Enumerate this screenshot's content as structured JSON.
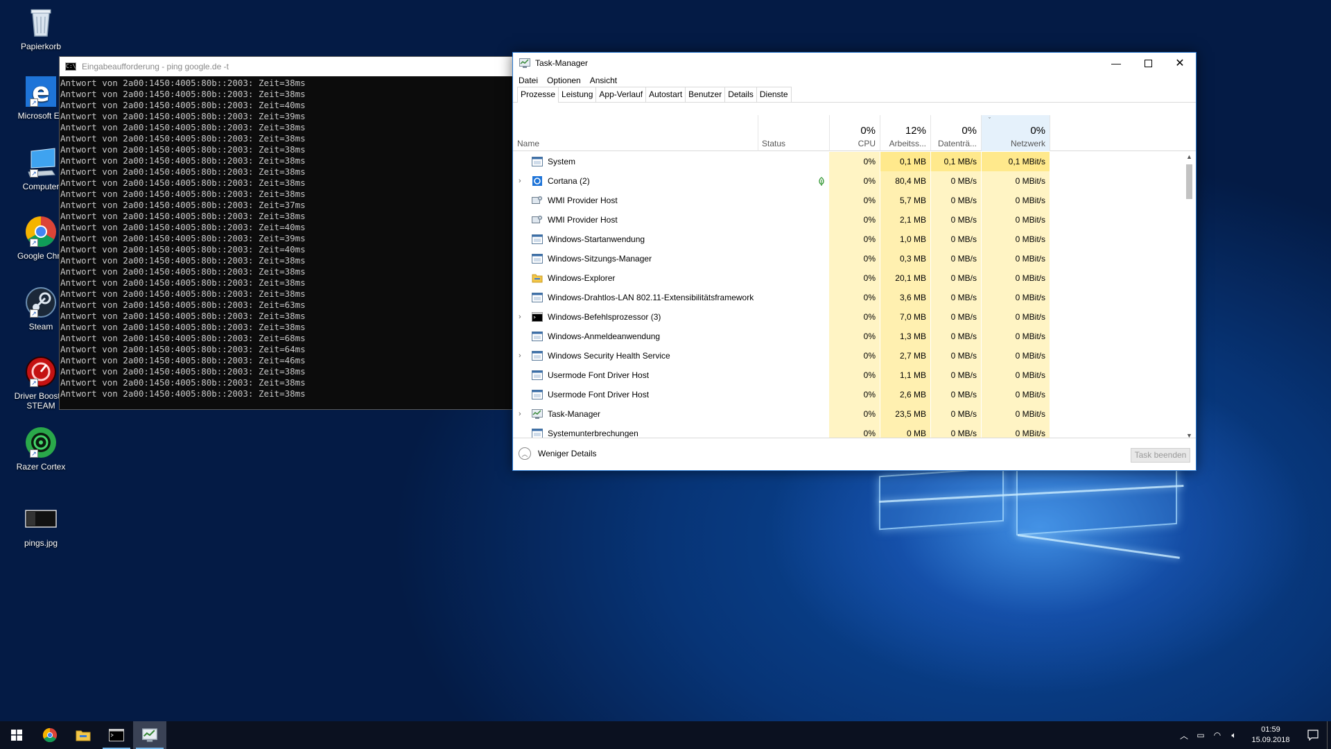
{
  "desktop": {
    "icons": [
      {
        "name": "recycle-bin",
        "label": "Papierkorb"
      },
      {
        "name": "edge",
        "label": "Microsoft Ed"
      },
      {
        "name": "computer",
        "label": "Computer"
      },
      {
        "name": "chrome",
        "label": "Google Chro"
      },
      {
        "name": "steam",
        "label": "Steam"
      },
      {
        "name": "driver-booster",
        "label": "Driver Booster STEAM"
      },
      {
        "name": "razer-cortex",
        "label": "Razer Cortex"
      },
      {
        "name": "pings-jpg",
        "label": "pings.jpg"
      }
    ]
  },
  "cmd": {
    "title": "Eingabeaufforderung - ping  google.de -t",
    "lines": [
      "Antwort von 2a00:1450:4005:80b::2003: Zeit=38ms",
      "Antwort von 2a00:1450:4005:80b::2003: Zeit=38ms",
      "Antwort von 2a00:1450:4005:80b::2003: Zeit=40ms",
      "Antwort von 2a00:1450:4005:80b::2003: Zeit=39ms",
      "Antwort von 2a00:1450:4005:80b::2003: Zeit=38ms",
      "Antwort von 2a00:1450:4005:80b::2003: Zeit=38ms",
      "Antwort von 2a00:1450:4005:80b::2003: Zeit=38ms",
      "Antwort von 2a00:1450:4005:80b::2003: Zeit=38ms",
      "Antwort von 2a00:1450:4005:80b::2003: Zeit=38ms",
      "Antwort von 2a00:1450:4005:80b::2003: Zeit=38ms",
      "Antwort von 2a00:1450:4005:80b::2003: Zeit=38ms",
      "Antwort von 2a00:1450:4005:80b::2003: Zeit=37ms",
      "Antwort von 2a00:1450:4005:80b::2003: Zeit=38ms",
      "Antwort von 2a00:1450:4005:80b::2003: Zeit=40ms",
      "Antwort von 2a00:1450:4005:80b::2003: Zeit=39ms",
      "Antwort von 2a00:1450:4005:80b::2003: Zeit=40ms",
      "Antwort von 2a00:1450:4005:80b::2003: Zeit=38ms",
      "Antwort von 2a00:1450:4005:80b::2003: Zeit=38ms",
      "Antwort von 2a00:1450:4005:80b::2003: Zeit=38ms",
      "Antwort von 2a00:1450:4005:80b::2003: Zeit=38ms",
      "Antwort von 2a00:1450:4005:80b::2003: Zeit=63ms",
      "Antwort von 2a00:1450:4005:80b::2003: Zeit=38ms",
      "Antwort von 2a00:1450:4005:80b::2003: Zeit=38ms",
      "Antwort von 2a00:1450:4005:80b::2003: Zeit=68ms",
      "Antwort von 2a00:1450:4005:80b::2003: Zeit=64ms",
      "Antwort von 2a00:1450:4005:80b::2003: Zeit=46ms",
      "Antwort von 2a00:1450:4005:80b::2003: Zeit=38ms",
      "Antwort von 2a00:1450:4005:80b::2003: Zeit=38ms",
      "Antwort von 2a00:1450:4005:80b::2003: Zeit=38ms"
    ]
  },
  "taskmanager": {
    "title": "Task-Manager",
    "menu": [
      "Datei",
      "Optionen",
      "Ansicht"
    ],
    "tabs": [
      "Prozesse",
      "Leistung",
      "App-Verlauf",
      "Autostart",
      "Benutzer",
      "Details",
      "Dienste"
    ],
    "active_tab": "Prozesse",
    "columns": {
      "name": "Name",
      "status": "Status",
      "cpu": {
        "pct": "0%",
        "label": "CPU"
      },
      "mem": {
        "pct": "12%",
        "label": "Arbeitss..."
      },
      "disk": {
        "pct": "0%",
        "label": "Datenträ..."
      },
      "net": {
        "pct": "0%",
        "label": "Netzwerk"
      }
    },
    "processes": [
      {
        "name": "System",
        "icon": "system-icon",
        "expandable": false,
        "status_icon": "",
        "cpu": "0%",
        "mem": "0,1 MB",
        "disk": "0,1 MB/s",
        "net": "0,1 MBit/s"
      },
      {
        "name": "Cortana (2)",
        "icon": "cortana-icon",
        "expandable": true,
        "status_icon": "leaf-icon",
        "cpu": "0%",
        "mem": "80,4 MB",
        "disk": "0 MB/s",
        "net": "0 MBit/s"
      },
      {
        "name": "WMI Provider Host",
        "icon": "wmi-icon",
        "expandable": false,
        "status_icon": "",
        "cpu": "0%",
        "mem": "5,7 MB",
        "disk": "0 MB/s",
        "net": "0 MBit/s"
      },
      {
        "name": "WMI Provider Host",
        "icon": "wmi-icon",
        "expandable": false,
        "status_icon": "",
        "cpu": "0%",
        "mem": "2,1 MB",
        "disk": "0 MB/s",
        "net": "0 MBit/s"
      },
      {
        "name": "Windows-Startanwendung",
        "icon": "app-window-icon",
        "expandable": false,
        "status_icon": "",
        "cpu": "0%",
        "mem": "1,0 MB",
        "disk": "0 MB/s",
        "net": "0 MBit/s"
      },
      {
        "name": "Windows-Sitzungs-Manager",
        "icon": "app-window-icon",
        "expandable": false,
        "status_icon": "",
        "cpu": "0%",
        "mem": "0,3 MB",
        "disk": "0 MB/s",
        "net": "0 MBit/s"
      },
      {
        "name": "Windows-Explorer",
        "icon": "folder-icon",
        "expandable": false,
        "status_icon": "",
        "cpu": "0%",
        "mem": "20,1 MB",
        "disk": "0 MB/s",
        "net": "0 MBit/s"
      },
      {
        "name": "Windows-Drahtlos-LAN 802.11-Extensibilitätsframework",
        "icon": "app-window-icon",
        "expandable": false,
        "status_icon": "",
        "cpu": "0%",
        "mem": "3,6 MB",
        "disk": "0 MB/s",
        "net": "0 MBit/s"
      },
      {
        "name": "Windows-Befehlsprozessor (3)",
        "icon": "cmd-icon",
        "expandable": true,
        "status_icon": "",
        "cpu": "0%",
        "mem": "7,0 MB",
        "disk": "0 MB/s",
        "net": "0 MBit/s"
      },
      {
        "name": "Windows-Anmeldeanwendung",
        "icon": "app-window-icon",
        "expandable": false,
        "status_icon": "",
        "cpu": "0%",
        "mem": "1,3 MB",
        "disk": "0 MB/s",
        "net": "0 MBit/s"
      },
      {
        "name": "Windows Security Health Service",
        "icon": "app-window-icon",
        "expandable": true,
        "status_icon": "",
        "cpu": "0%",
        "mem": "2,7 MB",
        "disk": "0 MB/s",
        "net": "0 MBit/s"
      },
      {
        "name": "Usermode Font Driver Host",
        "icon": "app-window-icon",
        "expandable": false,
        "status_icon": "",
        "cpu": "0%",
        "mem": "1,1 MB",
        "disk": "0 MB/s",
        "net": "0 MBit/s"
      },
      {
        "name": "Usermode Font Driver Host",
        "icon": "app-window-icon",
        "expandable": false,
        "status_icon": "",
        "cpu": "0%",
        "mem": "2,6 MB",
        "disk": "0 MB/s",
        "net": "0 MBit/s"
      },
      {
        "name": "Task-Manager",
        "icon": "taskmanager-icon",
        "expandable": true,
        "status_icon": "",
        "cpu": "0%",
        "mem": "23,5 MB",
        "disk": "0 MB/s",
        "net": "0 MBit/s"
      },
      {
        "name": "Systemunterbrechungen",
        "icon": "app-window-icon",
        "expandable": false,
        "status_icon": "",
        "cpu": "0%",
        "mem": "0 MB",
        "disk": "0 MB/s",
        "net": "0 MBit/s"
      }
    ],
    "fewer_details": "Weniger Details",
    "end_task": "Task beenden"
  },
  "taskbar": {
    "time": "01:59",
    "date": "15.09.2018"
  },
  "colors": {
    "accent": "#2a7bd5",
    "heat_low": "#fff4c4",
    "heat_mid": "#ffe98c"
  }
}
